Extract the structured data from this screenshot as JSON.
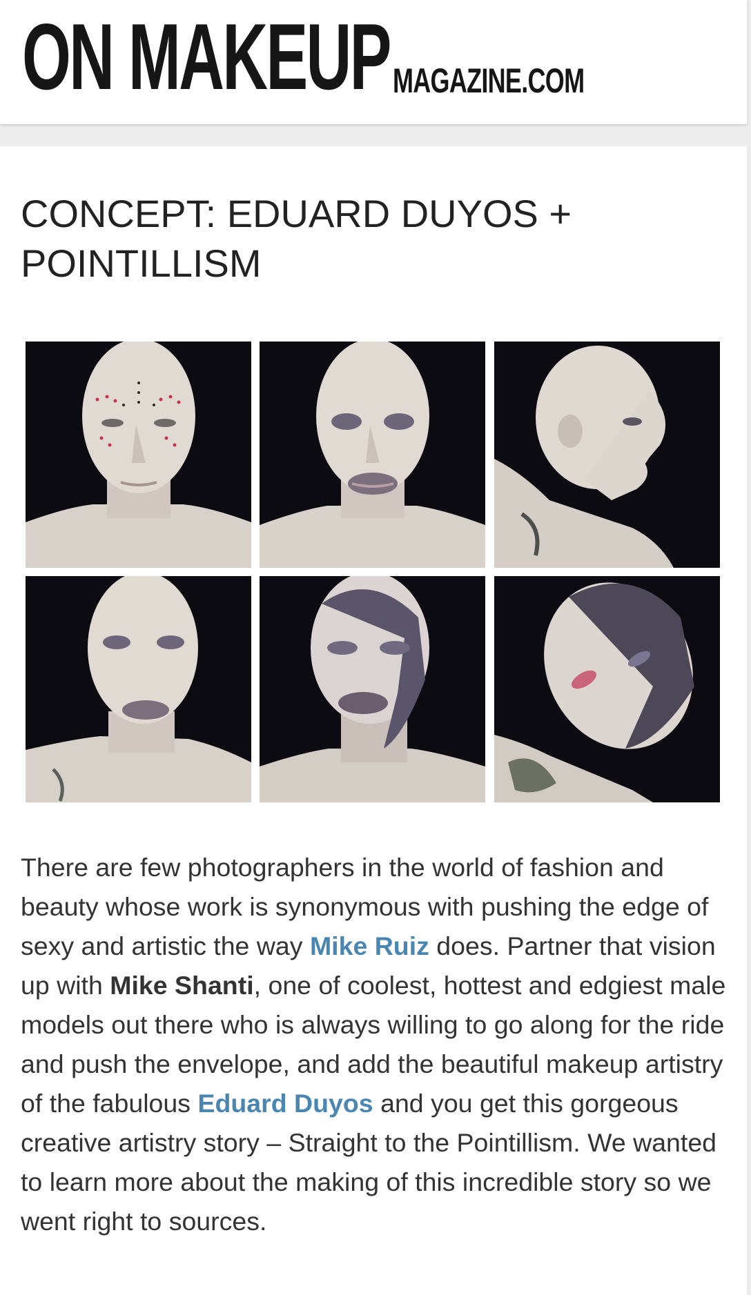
{
  "header": {
    "logo_main": "ON MAKEUP",
    "logo_sub": "MAGAZINE.COM"
  },
  "article": {
    "title": "CONCEPT: EDUARD DUYOS + POINTILLISM",
    "paragraph": {
      "text_1": "There are few photographers in the world of fashion and beauty whose work is synonymous with pushing the edge of sexy and artistic the way ",
      "link_1": "Mike Ruiz",
      "text_2": " does. Partner that vision up with ",
      "bold_1": "Mike Shanti",
      "text_3": ", one of coolest, hottest and edgiest male models out there who is always willing to go along for the ride and push the envelope, and add the beautiful makeup artistry of the fabulous ",
      "link_2": "Eduard Duyos",
      "text_4": " and you get this gorgeous creative artistry story – Straight to the Pointillism. We wanted to learn more about the making of this incredible story so we went right to sources."
    }
  },
  "gallery": {
    "photos": [
      {
        "pose": "front-face"
      },
      {
        "pose": "front-face"
      },
      {
        "pose": "profile-right"
      },
      {
        "pose": "three-quarter"
      },
      {
        "pose": "front-face"
      },
      {
        "pose": "tilted"
      }
    ]
  },
  "colors": {
    "link": "#4a86b2",
    "photo_background": "#0d0b12",
    "skin": "#ddd6cf"
  }
}
